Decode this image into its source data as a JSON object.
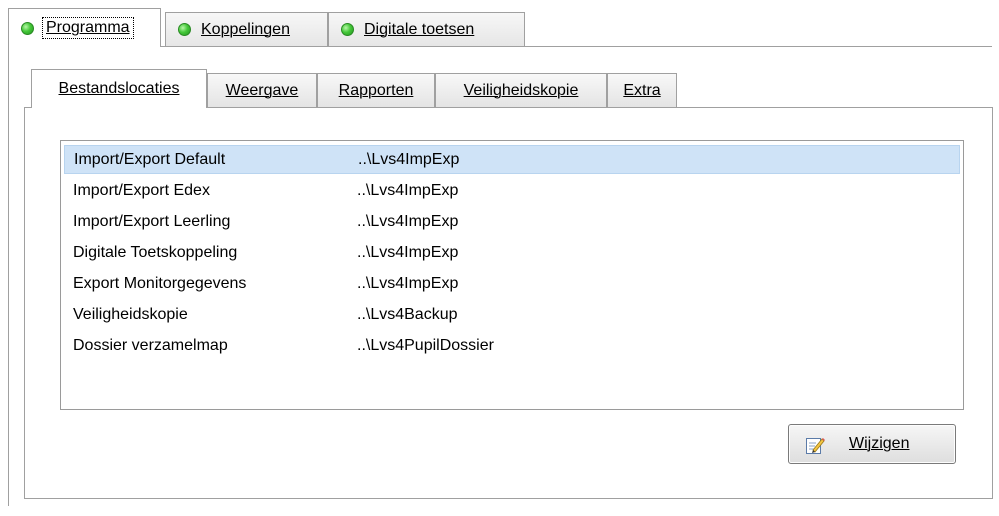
{
  "outer_tabs": [
    {
      "label": "Programma",
      "active": true
    },
    {
      "label": "Koppelingen",
      "active": false
    },
    {
      "label": "Digitale toetsen",
      "active": false
    }
  ],
  "inner_tabs": [
    {
      "label": "Bestandslocaties",
      "active": true
    },
    {
      "label": "Weergave",
      "active": false
    },
    {
      "label": "Rapporten",
      "active": false
    },
    {
      "label": "Veiligheidskopie",
      "active": false
    },
    {
      "label": "Extra",
      "active": false
    }
  ],
  "locations": [
    {
      "name": "Import/Export Default",
      "path": "..\\Lvs4ImpExp",
      "selected": true
    },
    {
      "name": "Import/Export Edex",
      "path": "..\\Lvs4ImpExp",
      "selected": false
    },
    {
      "name": "Import/Export Leerling",
      "path": "..\\Lvs4ImpExp",
      "selected": false
    },
    {
      "name": "Digitale Toetskoppeling",
      "path": "..\\Lvs4ImpExp",
      "selected": false
    },
    {
      "name": "Export Monitorgegevens",
      "path": "..\\Lvs4ImpExp",
      "selected": false
    },
    {
      "name": "Veiligheidskopie",
      "path": "..\\Lvs4Backup",
      "selected": false
    },
    {
      "name": "Dossier verzamelmap",
      "path": "..\\Lvs4PupilDossier",
      "selected": false
    }
  ],
  "buttons": {
    "edit_label": "Wijzigen",
    "edit_icon": "edit-pencil-icon"
  },
  "colors": {
    "selection": "#cfe3f7",
    "status_led": "#45c83a"
  }
}
